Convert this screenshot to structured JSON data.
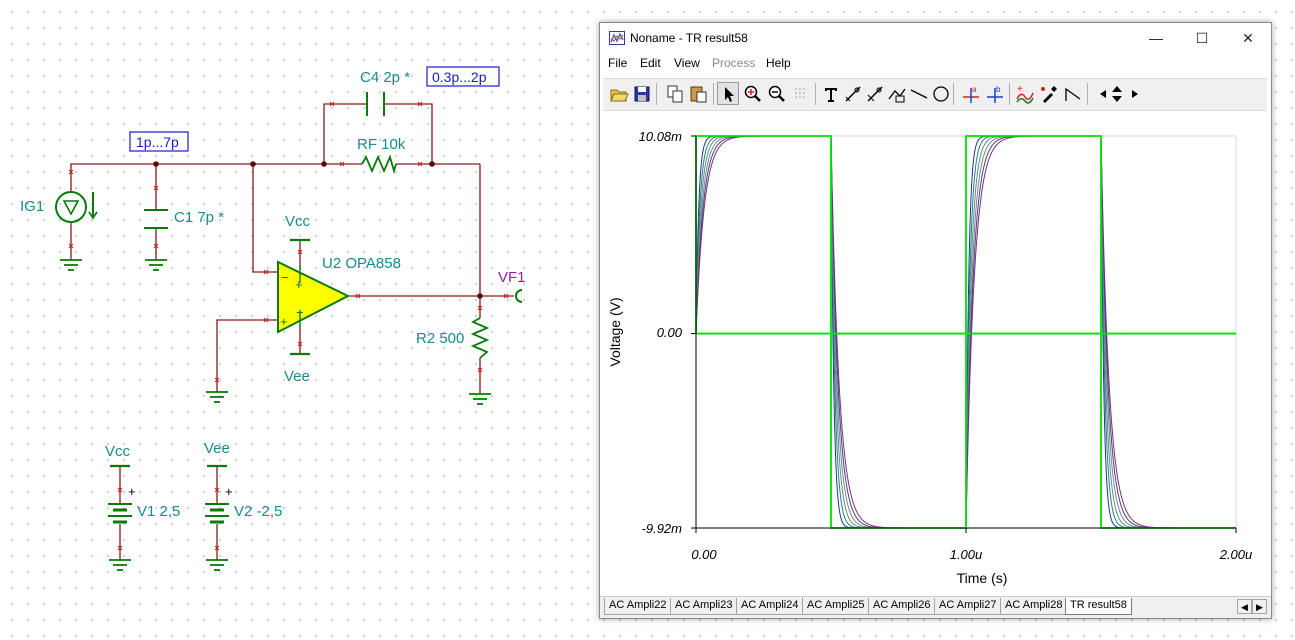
{
  "schematic": {
    "source_label": "IG1",
    "c1_label": "C1 7p *",
    "c1_range": "1p...7p",
    "c4_label": "C4 2p *",
    "c4_range": "0.3p...2p",
    "rf_label": "RF 10k",
    "opamp_label": "U2 OPA858",
    "vcc_label": "Vcc",
    "vee_label": "Vee",
    "vf_label": "VF1",
    "r2_label": "R2 500",
    "v1_net": "Vcc",
    "v1_label": "V1 2,5",
    "v2_net": "Vee",
    "v2_label": "V2 -2,5",
    "plus_sign": "+",
    "minus_sign": "−"
  },
  "window": {
    "title": "Noname - TR result58",
    "controls": {
      "minimize": "—",
      "maximize": "☐",
      "close": "✕"
    }
  },
  "menu": [
    {
      "label": "File",
      "disabled": false
    },
    {
      "label": "Edit",
      "disabled": false
    },
    {
      "label": "View",
      "disabled": false
    },
    {
      "label": "Process",
      "disabled": true
    },
    {
      "label": "Help",
      "disabled": false
    }
  ],
  "toolbar": {
    "icons": [
      "open-icon",
      "save-icon",
      "copy-icon",
      "paste-icon",
      "pointer-icon",
      "zoom-in-icon",
      "zoom-out-icon",
      "grid-icon",
      "text-icon",
      "cursor-a-icon",
      "cursor-b-icon",
      "curve-label-icon",
      "line-icon",
      "circle-icon",
      "cursor-a-marker-icon",
      "cursor-b-marker-icon",
      "waveform-add-icon",
      "color-picker-icon",
      "corner-icon",
      "nav-left-icon",
      "nav-updown-icon",
      "nav-right-icon"
    ]
  },
  "plot": {
    "yticks": [
      "10.08m",
      "0.00",
      "-9.92m"
    ],
    "xticks": [
      "0.00",
      "1.00u",
      "2.00u"
    ],
    "xlabel": "Time (s)",
    "ylabel": "Voltage (V)"
  },
  "chart_data": {
    "type": "line",
    "xlabel": "Time (s)",
    "ylabel": "Voltage (V)",
    "xlim": [
      0,
      2e-06
    ],
    "ylim": [
      -0.00992,
      0.01008
    ],
    "x_ticks": [
      "0.00",
      "1.00u",
      "2.00u"
    ],
    "y_ticks": [
      "10.08m",
      "0.00",
      "-9.92m"
    ],
    "grid": false,
    "series": [
      {
        "color": "#00e000",
        "x": [
          0,
          0.0,
          5e-07,
          5e-07,
          1e-06,
          1e-06,
          1.5e-06,
          1.5e-06,
          2e-06
        ],
        "y": [
          0,
          0.01008,
          0.01008,
          -0.00992,
          -0.00992,
          0.01008,
          0.01008,
          -0.00992,
          -0.00992
        ]
      },
      {
        "color": "#00e000",
        "x": [
          0,
          2e-06
        ],
        "y": [
          0,
          0
        ]
      },
      {
        "color": "#1a3a8a",
        "tau_s": 1e-08
      },
      {
        "color": "#2a7a9a",
        "tau_s": 1.4e-08
      },
      {
        "color": "#5a9a5a",
        "tau_s": 1.8e-08
      },
      {
        "color": "#7a7acc",
        "tau_s": 2.2e-08
      },
      {
        "color": "#4a4a4a",
        "tau_s": 2.6e-08
      },
      {
        "color": "#7a2a9a",
        "tau_s": 3e-08
      }
    ]
  },
  "tabs": [
    {
      "label": "AC Ampli22",
      "active": false
    },
    {
      "label": "AC Ampli23",
      "active": false
    },
    {
      "label": "AC Ampli24",
      "active": false
    },
    {
      "label": "AC Ampli25",
      "active": false
    },
    {
      "label": "AC Ampli26",
      "active": false
    },
    {
      "label": "AC Ampli27",
      "active": false
    },
    {
      "label": "AC Ampli28",
      "active": false
    },
    {
      "label": "TR result58",
      "active": true
    }
  ],
  "tab_scroll": {
    "left": "◀",
    "right": "▶"
  }
}
